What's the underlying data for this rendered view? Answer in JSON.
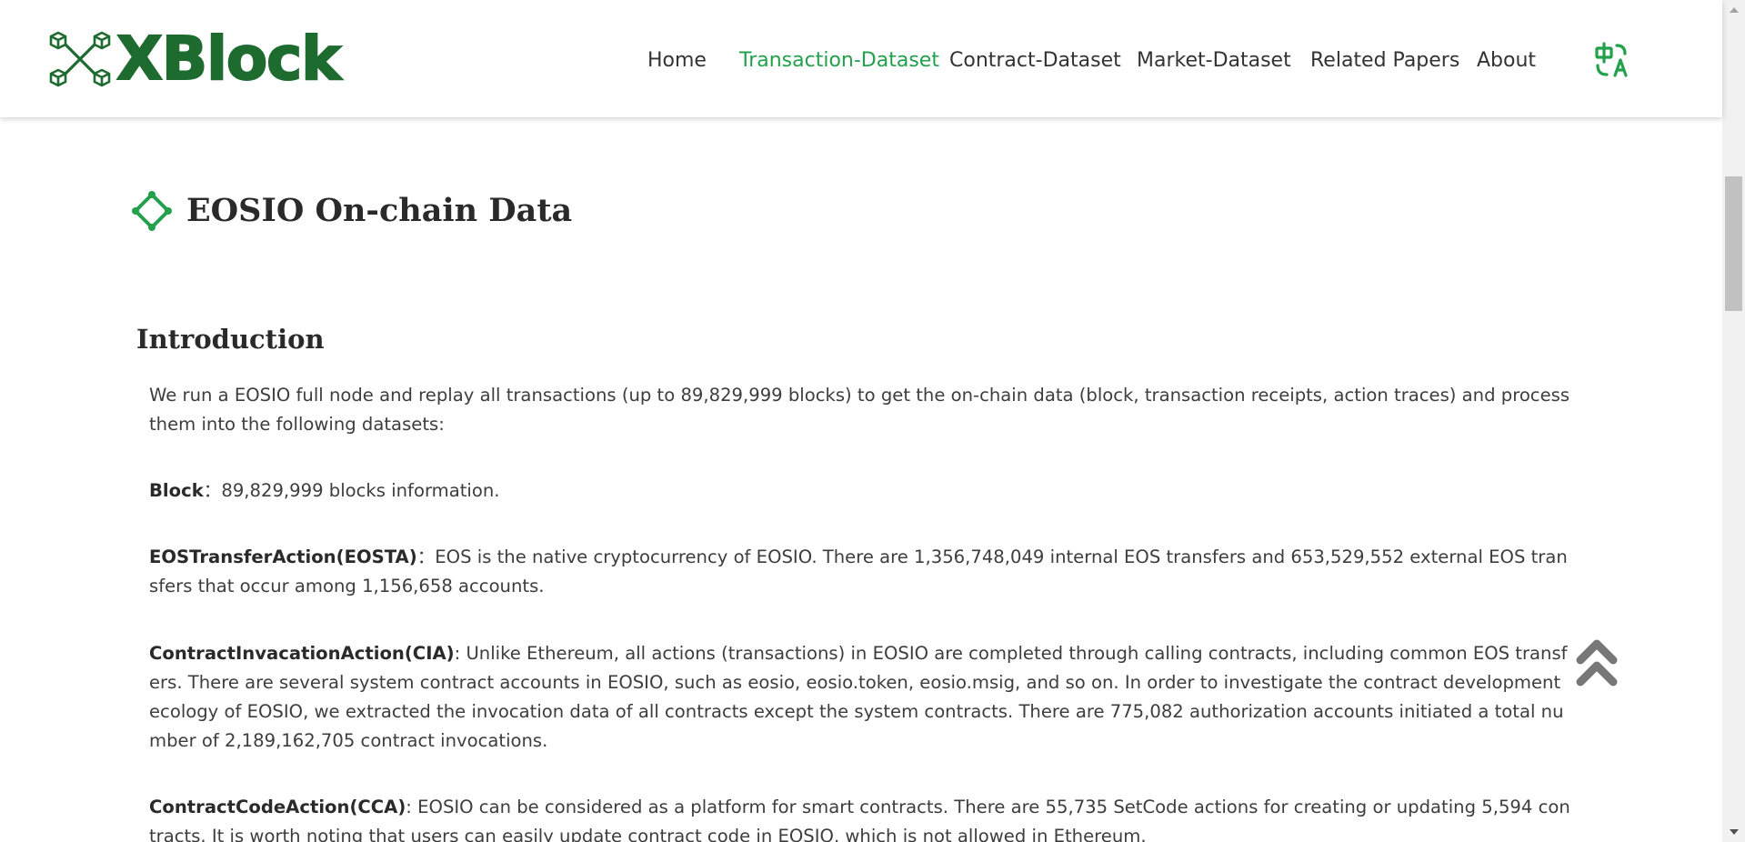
{
  "header": {
    "logo_text": "XBlock",
    "nav": [
      {
        "label": "Home",
        "active": false
      },
      {
        "label": "Transaction-Dataset",
        "active": true
      },
      {
        "label": "Contract-Dataset",
        "active": false
      },
      {
        "label": "Market-Dataset",
        "active": false
      },
      {
        "label": "Related Papers",
        "active": false
      },
      {
        "label": "About",
        "active": false
      }
    ],
    "language_icon": "translate-icon"
  },
  "colors": {
    "brand_green": "#1e6b30",
    "accent_green": "#22a04b",
    "text": "#333333",
    "scroll_icon": "#777777"
  },
  "page": {
    "title": "EOSIO On-chain Data",
    "title_icon": "diamond-icon",
    "section_heading": "Introduction",
    "intro": "We run a EOSIO full node and replay all transactions (up to 89,829,999 blocks) to get the on-chain data (block, transaction receipts, action traces) and process them into the following datasets:",
    "items": [
      {
        "term": "Block",
        "sep": "：",
        "text": "89,829,999 blocks information."
      },
      {
        "term": "EOSTransferAction(EOSTA)",
        "sep": "：",
        "text": "EOS is the native cryptocurrency of EOSIO. There are 1,356,748,049 internal EOS transfers and 653,529,552 external EOS transfers that occur among 1,156,658 accounts."
      },
      {
        "term": "ContractInvacationAction(CIA)",
        "sep": ": ",
        "text": "Unlike Ethereum, all actions (transactions) in EOSIO are completed through calling contracts, including common EOS transfers. There are several system contract accounts in EOSIO, such as eosio, eosio.token, eosio.msig, and so on. In order to investigate the contract development ecology of EOSIO, we extracted the invocation data of all contracts except the system contracts. There are 775,082 authorization accounts initiated a total number of 2,189,162,705 contract invocations."
      },
      {
        "term": "ContractCodeAction(CCA)",
        "sep": ": ",
        "text": "EOSIO can be considered as a platform for smart contracts. There are 55,735 SetCode actions for creating or updating 5,594 contracts. It is worth noting that users can easily update contract code in EOSIO, which is not allowed in Ethereum."
      }
    ],
    "back_to_top_icon": "double-chevron-up-icon"
  }
}
